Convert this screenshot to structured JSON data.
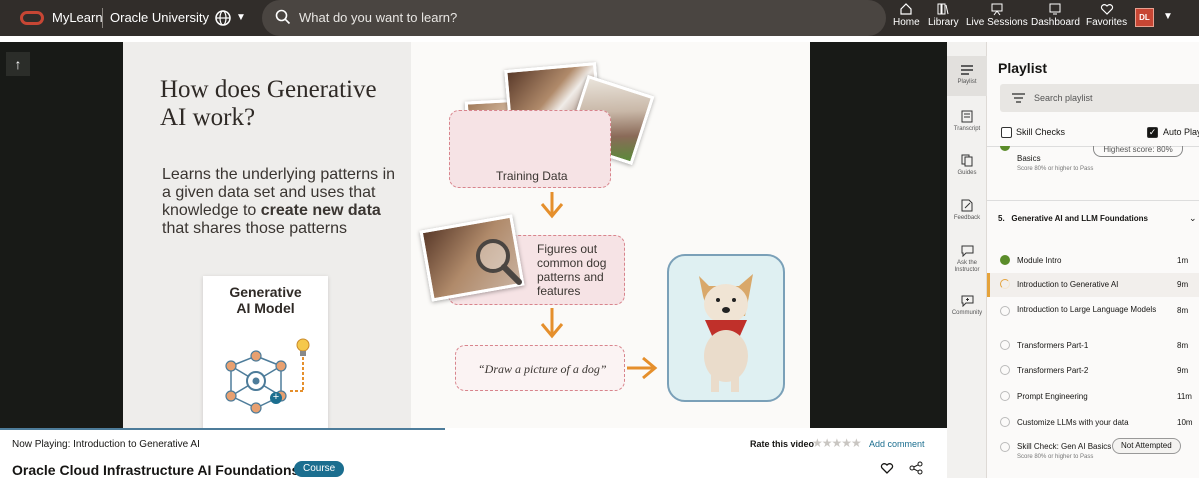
{
  "header": {
    "brand": "MyLearn",
    "brand2": "Oracle University",
    "search_placeholder": "What do you want to learn?",
    "nav": [
      {
        "label": "Home",
        "icon": "home-icon"
      },
      {
        "label": "Library",
        "icon": "library-icon"
      },
      {
        "label": "Live Sessions",
        "icon": "live-sessions-icon"
      },
      {
        "label": "Dashboard",
        "icon": "dashboard-icon"
      },
      {
        "label": "Favorites",
        "icon": "heart-icon"
      }
    ],
    "avatar": "DL"
  },
  "slide": {
    "title": "How does Generative AI work?",
    "body_pre": "Learns the underlying patterns in a given data set and uses that knowledge to ",
    "body_bold": "create new data",
    "body_post": " that shares those patterns",
    "model_title": "Generative\nAI Model",
    "training": "Training Data",
    "figures": "Figures out common dog patterns and features",
    "prompt": "“Draw a picture of a dog”"
  },
  "nowbar": {
    "now_label": "Now Playing:",
    "now_value": "Introduction to Generative AI",
    "course_title": "Oracle Cloud Infrastructure AI Foundations",
    "badge": "Course",
    "rate_label": "Rate this video",
    "add_comment": "Add comment",
    "progress": 0.47
  },
  "rail": [
    {
      "label": "Playlist",
      "icon": "playlist-icon"
    },
    {
      "label": "Transcript",
      "icon": "transcript-icon"
    },
    {
      "label": "Guides",
      "icon": "guides-icon"
    },
    {
      "label": "Feedback",
      "icon": "feedback-icon"
    },
    {
      "label": "Ask the Instructor",
      "icon": "ask-instructor-icon"
    },
    {
      "label": "Community",
      "icon": "community-icon"
    }
  ],
  "playlist": {
    "title": "Playlist",
    "search_placeholder": "Search playlist",
    "skill_checks": "Skill Checks",
    "auto_play": "Auto Play",
    "highest_score": "Highest score: 80%",
    "prev_item": "Basics",
    "prev_sub": "Score 80% or higher to Pass",
    "section": "5.   Generative AI and LLM Foundations",
    "items": [
      {
        "title": "Module Intro",
        "duration": "1m",
        "status": "done"
      },
      {
        "title": "Introduction to Generative AI",
        "duration": "9m",
        "status": "current"
      },
      {
        "title": "Introduction to Large Language Models",
        "duration": "8m",
        "status": ""
      },
      {
        "title": "Transformers Part-1",
        "duration": "8m",
        "status": ""
      },
      {
        "title": "Transformers Part-2",
        "duration": "9m",
        "status": ""
      },
      {
        "title": "Prompt Engineering",
        "duration": "11m",
        "status": ""
      },
      {
        "title": "Customize LLMs with your data",
        "duration": "10m",
        "status": ""
      },
      {
        "title": "Skill Check: Gen AI Basics",
        "duration": "",
        "status": ""
      }
    ],
    "not_attempted": "Not Attempted",
    "skill_sub": "Score 80% or higher to Pass"
  }
}
